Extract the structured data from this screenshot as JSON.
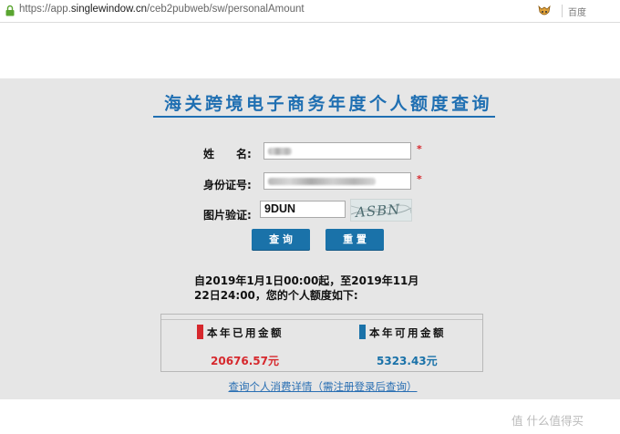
{
  "browser": {
    "url_prefix": "https://app.",
    "url_domain": "singlewindow.cn",
    "url_path": "/ceb2pubweb/sw/personalAmount",
    "search_engine": "百度"
  },
  "page": {
    "title": "海关跨境电子商务年度个人额度查询"
  },
  "form": {
    "name_label": "姓　　名:",
    "id_label": "身份证号:",
    "captcha_label": "图片验证:",
    "captcha_value": "9DUN",
    "captcha_image_text": "ASBN",
    "required_mark": "*",
    "query_button": "查 询",
    "reset_button": "重 置"
  },
  "result": {
    "summary": "自2019年1月1日00:00起，至2019年11月22日24:00，您的个人额度如下:",
    "used_label": "本年已用金额",
    "used_value": "20676.57元",
    "available_label": "本年可用金额",
    "available_value": "5323.43元",
    "detail_link": "查询个人消费详情（需注册登录后查询）"
  },
  "colors": {
    "accent_blue": "#1f6fb2",
    "button_blue": "#1a72a9",
    "used_red": "#d6282d",
    "available_blue": "#1a72a9"
  },
  "watermark": {
    "text": "值 什么值得买"
  }
}
